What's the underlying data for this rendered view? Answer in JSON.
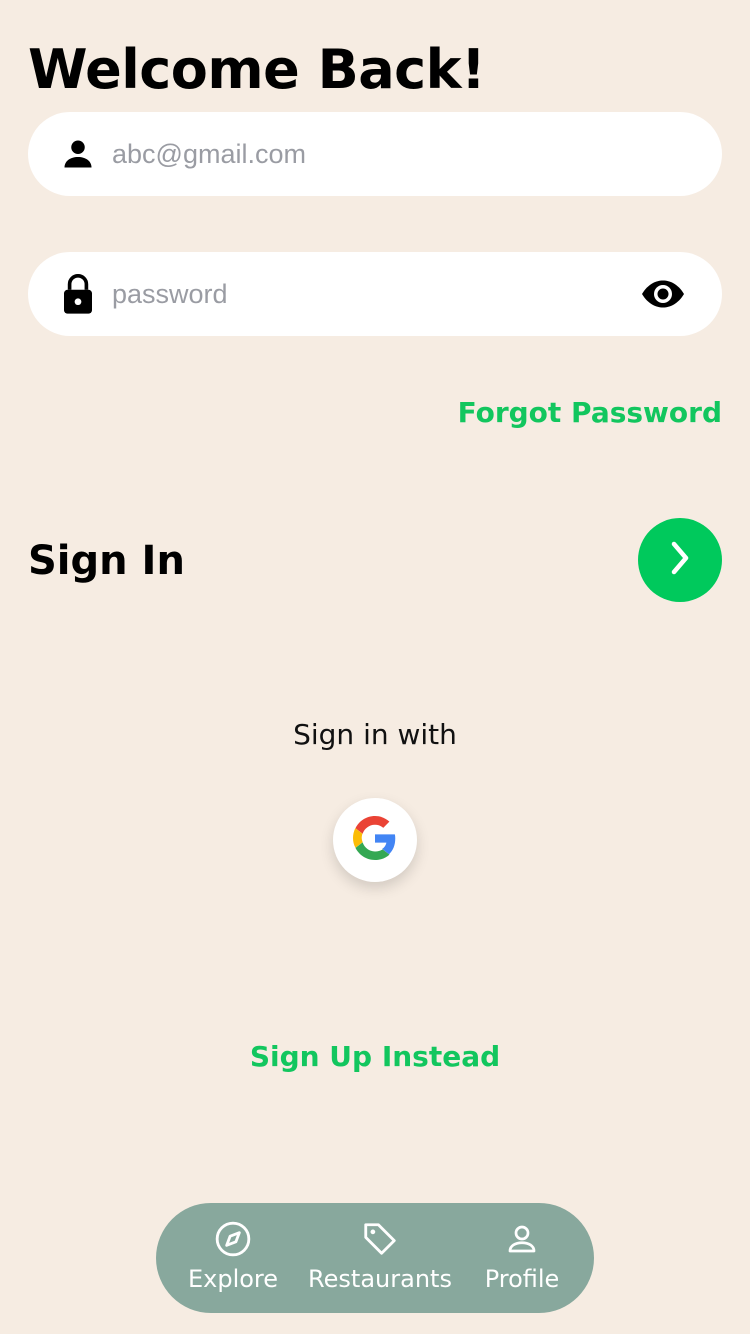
{
  "title": "Welcome Back!",
  "email_field": {
    "placeholder": "abc@gmail.com",
    "value": "",
    "icon": "person-icon"
  },
  "password_field": {
    "placeholder": "password",
    "value": "",
    "icon": "lock-icon",
    "toggle_icon": "eye-icon"
  },
  "forgot_label": "Forgot Password",
  "sign_in": {
    "label": "Sign In",
    "button_icon": "chevron-right-icon"
  },
  "sign_in_with": {
    "label": "Sign in with",
    "provider_icon": "google-icon"
  },
  "sign_up_label": "Sign Up Instead",
  "tabbar": {
    "items": [
      {
        "label": "Explore",
        "icon": "compass-icon"
      },
      {
        "label": "Restaurants",
        "icon": "tag-icon"
      },
      {
        "label": "Profile",
        "icon": "person-outline-icon"
      }
    ]
  },
  "colors": {
    "background": "#F6ECE2",
    "accent": "#00C95C",
    "link": "#12C65E",
    "tabbar": "#88A89D"
  }
}
